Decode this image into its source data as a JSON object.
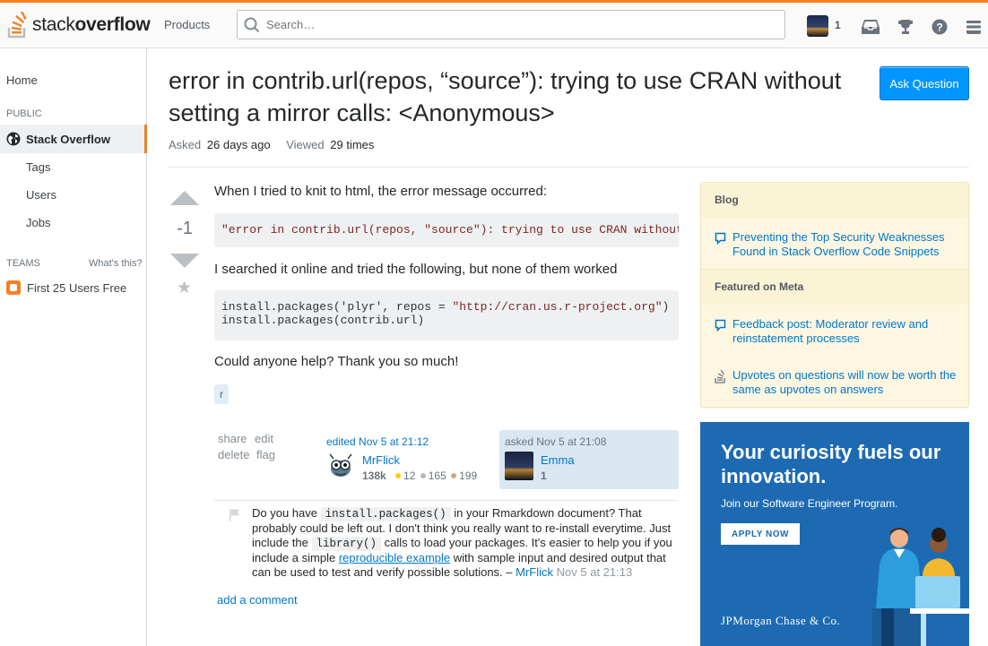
{
  "topbar": {
    "logo_light": "stack",
    "logo_bold": "overflow",
    "products_label": "Products",
    "search_placeholder": "Search…",
    "reputation": "1"
  },
  "leftnav": {
    "home": "Home",
    "public_header": "PUBLIC",
    "stack_overflow": "Stack Overflow",
    "tags": "Tags",
    "users": "Users",
    "jobs": "Jobs",
    "teams_header": "TEAMS",
    "whats_this": "What's this?",
    "teams_item": "First 25 Users Free"
  },
  "question": {
    "title": "error in contrib.url(repos, “source”): trying to use CRAN without setting a mirror calls: <Anonymous>",
    "ask_button": "Ask Question",
    "asked_label": "Asked",
    "asked_value": "26 days ago",
    "viewed_label": "Viewed",
    "viewed_value": "29 times",
    "votes": "-1",
    "body_p1": "When I tried to knit to html, the error message occurred:",
    "code1": "\"error in contrib.url(repos, \"source\"): trying to use CRAN without setting a mirror calls: <Anonymous>\"",
    "body_p2": "I searched it online and tried the following, but none of them worked",
    "code2_line1_a": "install.packages('plyr', repos = ",
    "code2_line1_str": "\"http://cran.us.r-project.org\"",
    "code2_line1_b": ")",
    "code2_line2": "install.packages(contrib.url)",
    "body_p3": "Could anyone help? Thank you so much!",
    "tag": "r",
    "menu": {
      "share": "share",
      "edit": "edit",
      "delete": "delete",
      "flag": "flag"
    }
  },
  "editor": {
    "action": "edited Nov 5 at 21:12",
    "name": "MrFlick",
    "rep": "138k",
    "gold": "12",
    "silver": "165",
    "bronze": "199"
  },
  "asker": {
    "action": "asked Nov 5 at 21:08",
    "name": "Emma",
    "rep": "1"
  },
  "comment": {
    "t1": "Do you have ",
    "c1": "install.packages()",
    "t2": " in your Rmarkdown document? That probably could be left out. I don't think you really want to re-install everytime. Just include the ",
    "c2": "library()",
    "t3": " calls to load your packages. It's easier to help you if you include a simple ",
    "link": "reproducible example",
    "t4": " with sample input and desired output that can be used to test and verify possible solutions. – ",
    "author": "MrFlick",
    "time": "Nov 5 at 21:13",
    "add": "add a comment"
  },
  "widget": {
    "blog_header": "Blog",
    "blog_item": "Preventing the Top Security Weaknesses Found in Stack Overflow Code Snippets",
    "meta_header": "Featured on Meta",
    "meta_item1": "Feedback post: Moderator review and reinstatement processes",
    "meta_item2": "Upvotes on questions will now be worth the same as upvotes on answers"
  },
  "ad": {
    "headline": "Your curiosity fuels our innovation.",
    "sub": "Join our Software Engineer Program.",
    "button": "APPLY NOW",
    "brand": "JPMorgan Chase & Co."
  },
  "colors": {
    "accent": "#f48024",
    "link": "#0077cc",
    "button": "#0095ff",
    "ad_bg": "#1d6ab3"
  }
}
